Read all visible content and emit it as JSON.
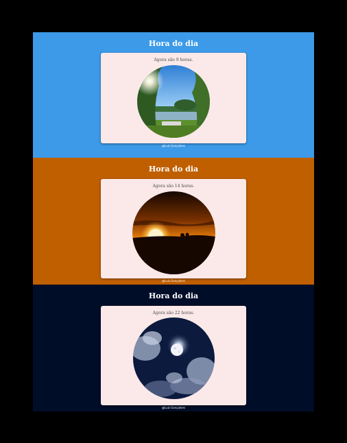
{
  "sections": [
    {
      "title": "Hora do dia",
      "message": "Agora são 9 horas.",
      "credit": "@Luiz Gonçalves",
      "background": "#3d9ae8",
      "image": "morning-sky-trees-photo"
    },
    {
      "title": "Hora do dia",
      "message": "Agora são 14 horas.",
      "credit": "@Luiz Gonçalves",
      "background": "#c05f00",
      "image": "sunset-photo"
    },
    {
      "title": "Hora do dia",
      "message": "Agora são 22 horas.",
      "credit": "@Luiz Gonçalves",
      "background": "#000d28",
      "image": "moon-clouds-photo"
    }
  ]
}
